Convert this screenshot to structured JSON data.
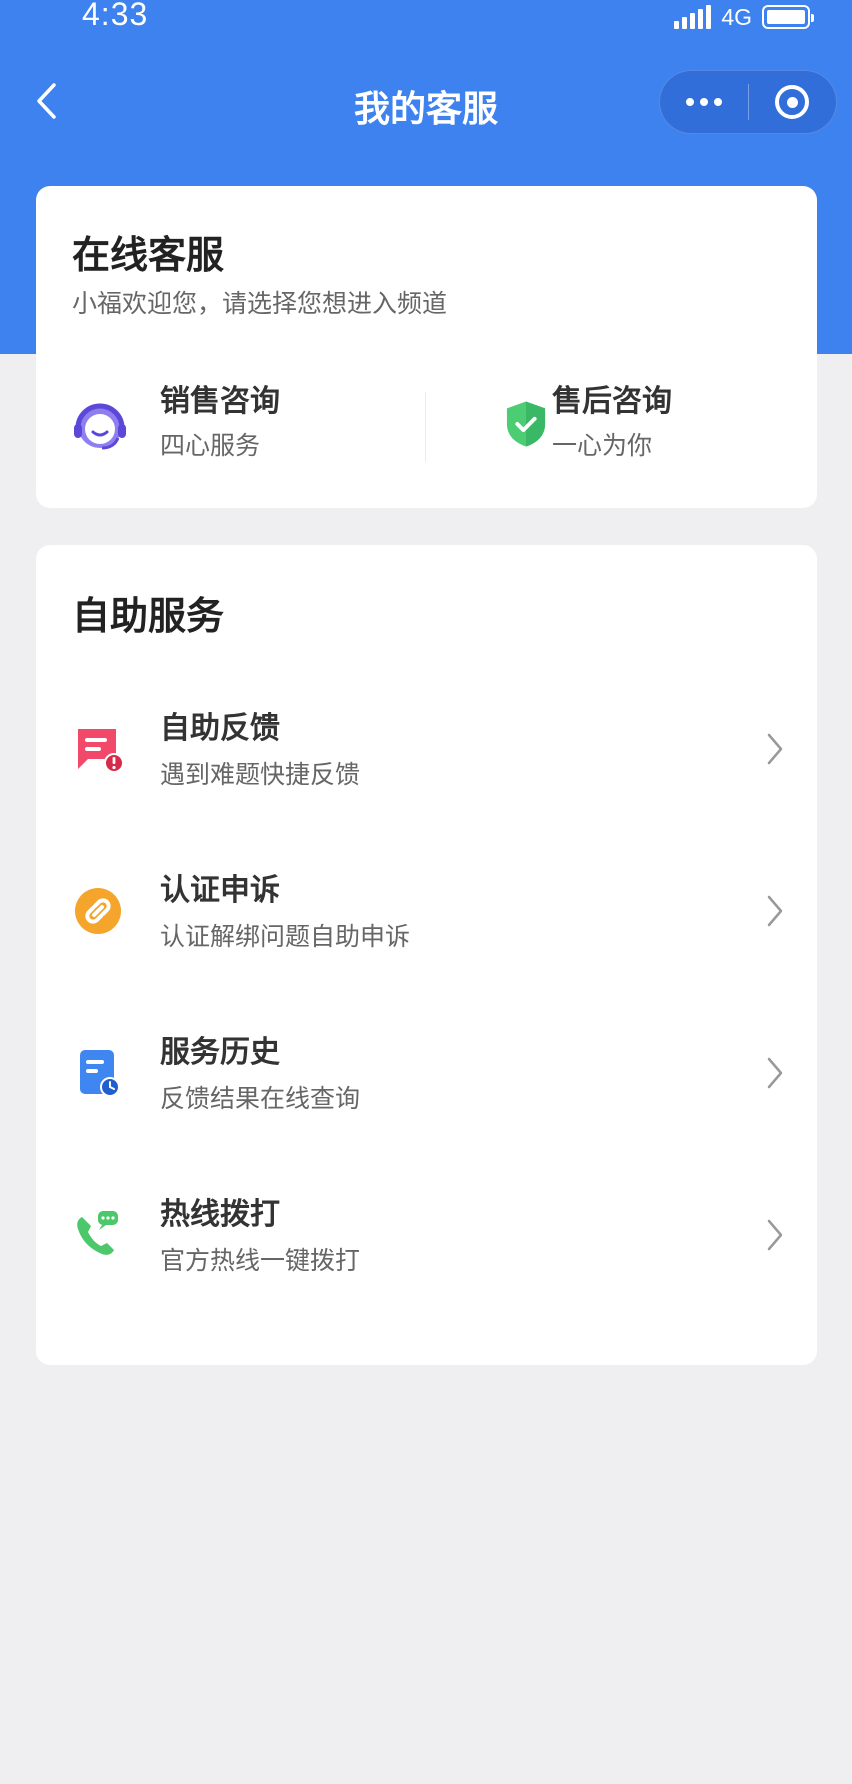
{
  "status_bar": {
    "time": "4:33",
    "network": "4G"
  },
  "nav": {
    "title": "我的客服"
  },
  "online_service": {
    "title": "在线客服",
    "subtitle": "小福欢迎您，请选择您想进入频道",
    "channels": [
      {
        "name": "销售咨询",
        "desc": "四心服务",
        "icon": "headset-icon",
        "color": "#6c5ce7"
      },
      {
        "name": "售后咨询",
        "desc": "一心为你",
        "icon": "shield-check-icon",
        "color": "#3fc06b"
      }
    ]
  },
  "self_service": {
    "title": "自助服务",
    "items": [
      {
        "name": "自助反馈",
        "desc": "遇到难题快捷反馈",
        "icon": "feedback-icon",
        "color": "#f2496a"
      },
      {
        "name": "认证申诉",
        "desc": "认证解绑问题自助申诉",
        "icon": "link-icon",
        "color": "#f5a42c"
      },
      {
        "name": "服务历史",
        "desc": "反馈结果在线查询",
        "icon": "document-clock-icon",
        "color": "#3f86f0"
      },
      {
        "name": "热线拨打",
        "desc": "官方热线一键拨打",
        "icon": "phone-chat-icon",
        "color": "#4cc86a"
      }
    ]
  },
  "colors": {
    "brand_blue": "#3d82ee",
    "page_bg": "#efeff1"
  }
}
